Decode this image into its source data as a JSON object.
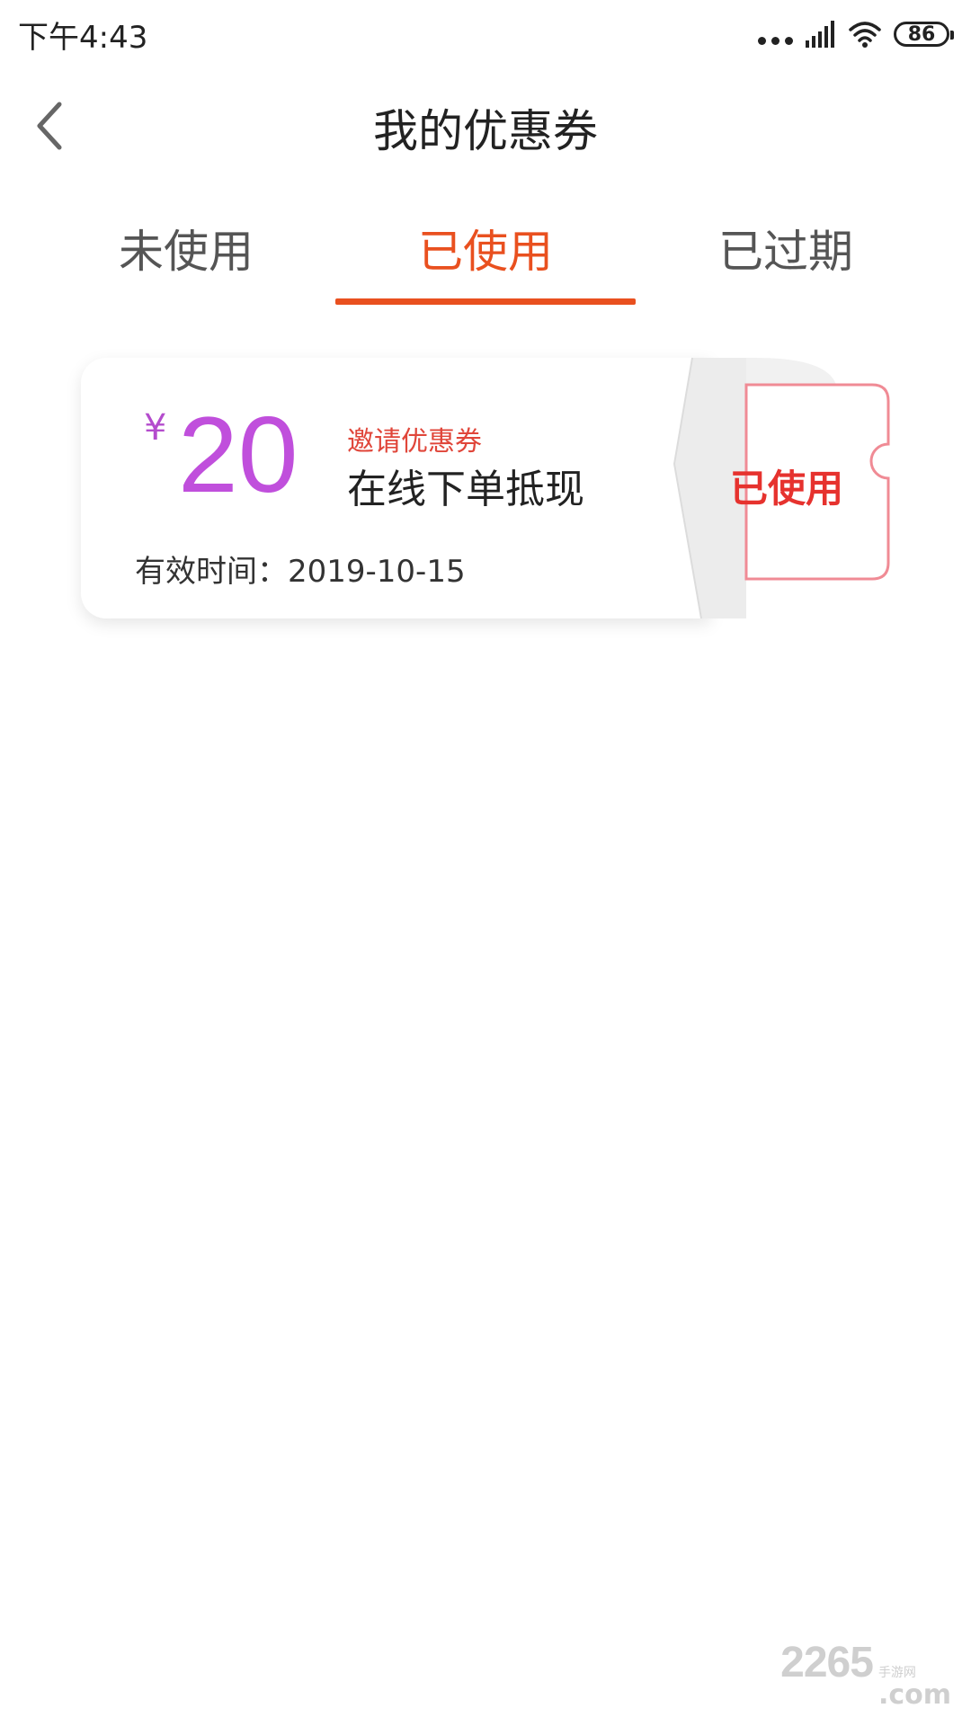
{
  "status_bar": {
    "time": "下午4:43",
    "battery": "86"
  },
  "header": {
    "title": "我的优惠券",
    "back_icon": "chevron-left-icon"
  },
  "tabs": [
    {
      "label": "未使用",
      "active": false
    },
    {
      "label": "已使用",
      "active": true
    },
    {
      "label": "已过期",
      "active": false
    }
  ],
  "coupon": {
    "currency": "¥",
    "amount": "20",
    "type": "邀请优惠券",
    "description": "在线下单抵现",
    "validity": "有效时间：2019-10-15",
    "status": "已使用"
  },
  "watermark": {
    "number": "2265",
    "domain": ".com",
    "site_name": "手游网"
  },
  "colors": {
    "accent": "#e9501f",
    "amount": "#c04fdc",
    "status_red": "#e6322e"
  }
}
